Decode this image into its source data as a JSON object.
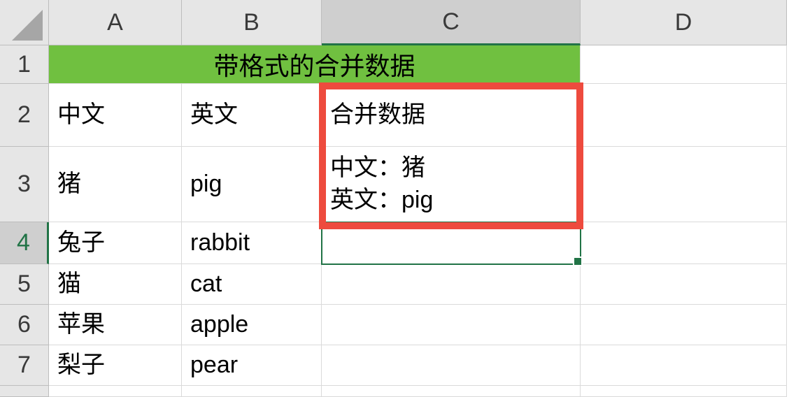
{
  "columns": [
    "A",
    "B",
    "C",
    "D"
  ],
  "rowNumbers": [
    "1",
    "2",
    "3",
    "4",
    "5",
    "6",
    "7"
  ],
  "selected": {
    "col": "C",
    "row": "4"
  },
  "title": "带格式的合并数据",
  "headers": {
    "a": "中文",
    "b": "英文",
    "c": "合并数据"
  },
  "rows": [
    {
      "a": "猪",
      "b": "pig",
      "c": "中文：猪\n英文：pig"
    },
    {
      "a": "兔子",
      "b": "rabbit",
      "c": ""
    },
    {
      "a": "猫",
      "b": "cat",
      "c": ""
    },
    {
      "a": "苹果",
      "b": "apple",
      "c": ""
    },
    {
      "a": "梨子",
      "b": "pear",
      "c": ""
    }
  ],
  "colors": {
    "titleBg": "#70C040",
    "accent": "#217346",
    "highlightBox": "#ee4b3e"
  }
}
